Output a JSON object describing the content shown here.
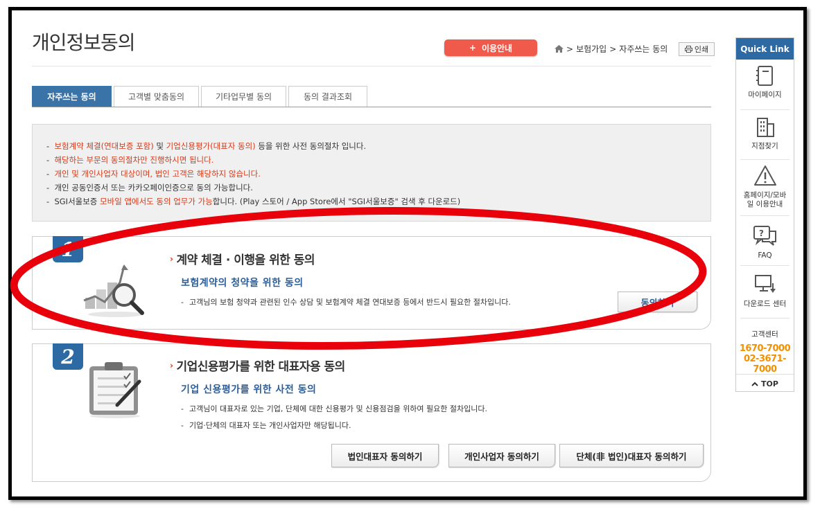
{
  "page": {
    "title": "개인정보동의",
    "guide_button": "이용안내",
    "guide_plus": "+",
    "breadcrumb": [
      "보험가입",
      "자주쓰는 동의"
    ],
    "breadcrumb_sep": ">",
    "print_button": "인쇄"
  },
  "tabs": [
    {
      "label": "자주쓰는 동의",
      "active": true
    },
    {
      "label": "고객별 맞춤동의",
      "active": false
    },
    {
      "label": "기타업무별 동의",
      "active": false
    },
    {
      "label": "동의 결과조회",
      "active": false
    }
  ],
  "notice": {
    "line1": {
      "red1": "보험계약 체결(연대보증 포함)",
      "mid1": " 및 ",
      "red2": "기업신용평가(대표자 동의)",
      "tail": " 등을 위한 사전 동의절차 입니다."
    },
    "line2": "해당하는 부문의 동의절차만 진행하시면 됩니다.",
    "line3": "개인 및 개인사업자 대상이며, 법인 고객은 해당하지 않습니다.",
    "line4": "개인 공동인증서 또는 카카오페이인증으로 동의 가능합니다.",
    "line5": {
      "head": "SGI서울보증 ",
      "red": "모바일 앱에서도 동의 업무가 가능",
      "tail": "합니다. (Play 스토어 / App Store에서 \"SGI서울보증\" 검색 후 다운로드)"
    },
    "bullet": "-"
  },
  "cards": [
    {
      "number": "1",
      "title": "계약 체결 · 이행을 위한 동의",
      "subtitle": "보험계약의 청약을 위한 동의",
      "desc": [
        "고객님의 보험 청약과 관련된 인수 상담 및 보험계약 체결 연대보증 등에서 반드시 필요한 절차입니다."
      ],
      "buttons": [
        "동의하기"
      ]
    },
    {
      "number": "2",
      "title": "기업신용평가를 위한 대표자용 동의",
      "subtitle": "기업 신용평가를 위한 사전 동의",
      "desc": [
        "고객님이 대표자로 있는 기업, 단체에 대한 신용평가 및 신용점검을 위하여 필요한 절차입니다.",
        "기업·단체의 대표자 또는 개인사업자만 해당됩니다."
      ],
      "buttons": [
        "법인대표자 동의하기",
        "개인사업자 동의하기",
        "단체(非 법인)대표자 동의하기"
      ]
    }
  ],
  "quick_link": {
    "title": "Quick Link",
    "items": [
      "마이페이지",
      "지점찾기",
      "홈페이지/모바일 이용안내",
      "FAQ",
      "다운로드 센터"
    ],
    "center_label": "고객센터",
    "phones": [
      "1670-7000",
      "02-3671-7000"
    ],
    "top_label": "TOP"
  },
  "colors": {
    "accent": "#2d6aa3",
    "red": "#d23b1a",
    "orange": "#f29000",
    "guide": "#f05a4b",
    "annotation": "#e8000b"
  },
  "icons": [
    "home-icon",
    "printer-icon",
    "chart-magnifier-icon",
    "clipboard-pen-icon",
    "notebook-icon",
    "building-icon",
    "warning-icon",
    "faq-bubble-icon",
    "download-monitor-icon",
    "chevron-up-icon"
  ]
}
